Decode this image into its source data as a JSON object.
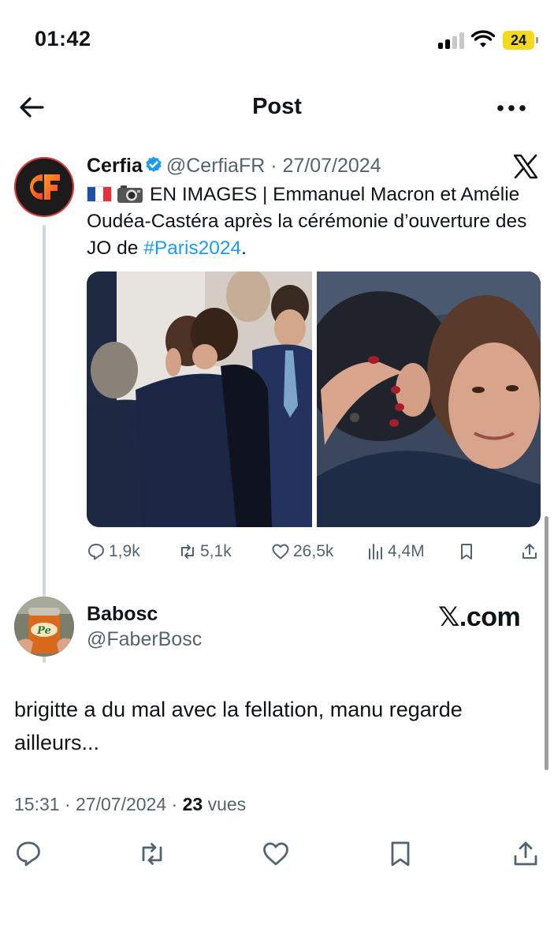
{
  "status_bar": {
    "time": "01:42",
    "battery": "24",
    "battery_color": "#f5d91e"
  },
  "nav": {
    "title": "Post",
    "back_icon": "arrow-left-icon",
    "more_icon": "more-horizontal-icon"
  },
  "quoted_post": {
    "author_name": "Cerfia",
    "author_handle": "@CerfiaFR",
    "separator": " · ",
    "date": "27/07/2024",
    "verified": true,
    "text_intro": "EN IMAGES | Emmanuel Macron et Amélie Oudéa-Castéra après la cérémonie d’ouverture des JO de ",
    "hashtag": "#Paris2024",
    "text_end": ".",
    "emoji": [
      "flag-france-icon",
      "camera-icon"
    ],
    "avatar_logo": "CF",
    "stats": {
      "replies": "1,9k",
      "reposts": "5,1k",
      "likes": "26,5k",
      "views": "4,4M"
    }
  },
  "reply_post": {
    "author_name": "Babosc",
    "author_handle": "@FaberBosc",
    "watermark": "𝕏.com",
    "text": "brigitte a du mal avec la fellation, manu regarde ailleurs...",
    "time": "15:31",
    "date": "27/07/2024",
    "views_count": "23",
    "views_label": "vues"
  },
  "colors": {
    "accent": "#1d9bf0",
    "text": "#0f1419",
    "secondary_text": "#536471",
    "thread_line": "#cfd9de"
  }
}
